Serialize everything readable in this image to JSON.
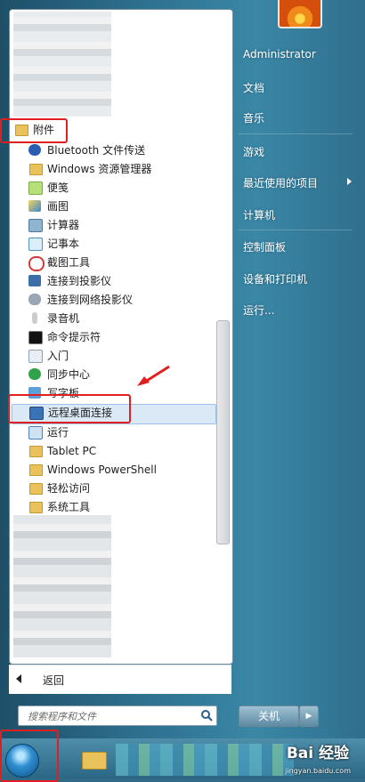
{
  "menu": {
    "accessories_folder": "附件",
    "programs": [
      {
        "label": "Bluetooth 文件传送",
        "icon": "bluetooth-icon"
      },
      {
        "label": "Windows 资源管理器",
        "icon": "explorer-folder-icon"
      },
      {
        "label": "便笺",
        "icon": "sticky-notes-icon"
      },
      {
        "label": "画图",
        "icon": "paint-icon"
      },
      {
        "label": "计算器",
        "icon": "calculator-icon"
      },
      {
        "label": "记事本",
        "icon": "notepad-icon"
      },
      {
        "label": "截图工具",
        "icon": "snipping-tool-icon"
      },
      {
        "label": "连接到投影仪",
        "icon": "projector-icon"
      },
      {
        "label": "连接到网络投影仪",
        "icon": "network-projector-icon"
      },
      {
        "label": "录音机",
        "icon": "microphone-icon"
      },
      {
        "label": "命令提示符",
        "icon": "cmd-icon"
      },
      {
        "label": "入门",
        "icon": "getting-started-icon"
      },
      {
        "label": "同步中心",
        "icon": "sync-center-icon"
      },
      {
        "label": "写字板",
        "icon": "wordpad-icon"
      },
      {
        "label": "远程桌面连接",
        "icon": "remote-desktop-icon"
      },
      {
        "label": "运行",
        "icon": "run-icon"
      },
      {
        "label": "Tablet PC",
        "icon": "folder-icon"
      },
      {
        "label": "Windows PowerShell",
        "icon": "folder-icon"
      },
      {
        "label": "轻松访问",
        "icon": "folder-icon"
      },
      {
        "label": "系统工具",
        "icon": "folder-icon"
      }
    ],
    "back_label": "返回",
    "search_placeholder": "搜索程序和文件"
  },
  "right": {
    "items": [
      "Administrator",
      "文档",
      "音乐",
      "游戏",
      "最近使用的项目",
      "计算机",
      "控制面板",
      "设备和打印机",
      "运行..."
    ],
    "shutdown_label": "关机"
  },
  "watermark": {
    "brand": "Bai 经验",
    "url": "jingyan.baidu.com"
  },
  "colors": {
    "highlight_box": "#e02020",
    "selected_row": "#dbe9f7"
  }
}
